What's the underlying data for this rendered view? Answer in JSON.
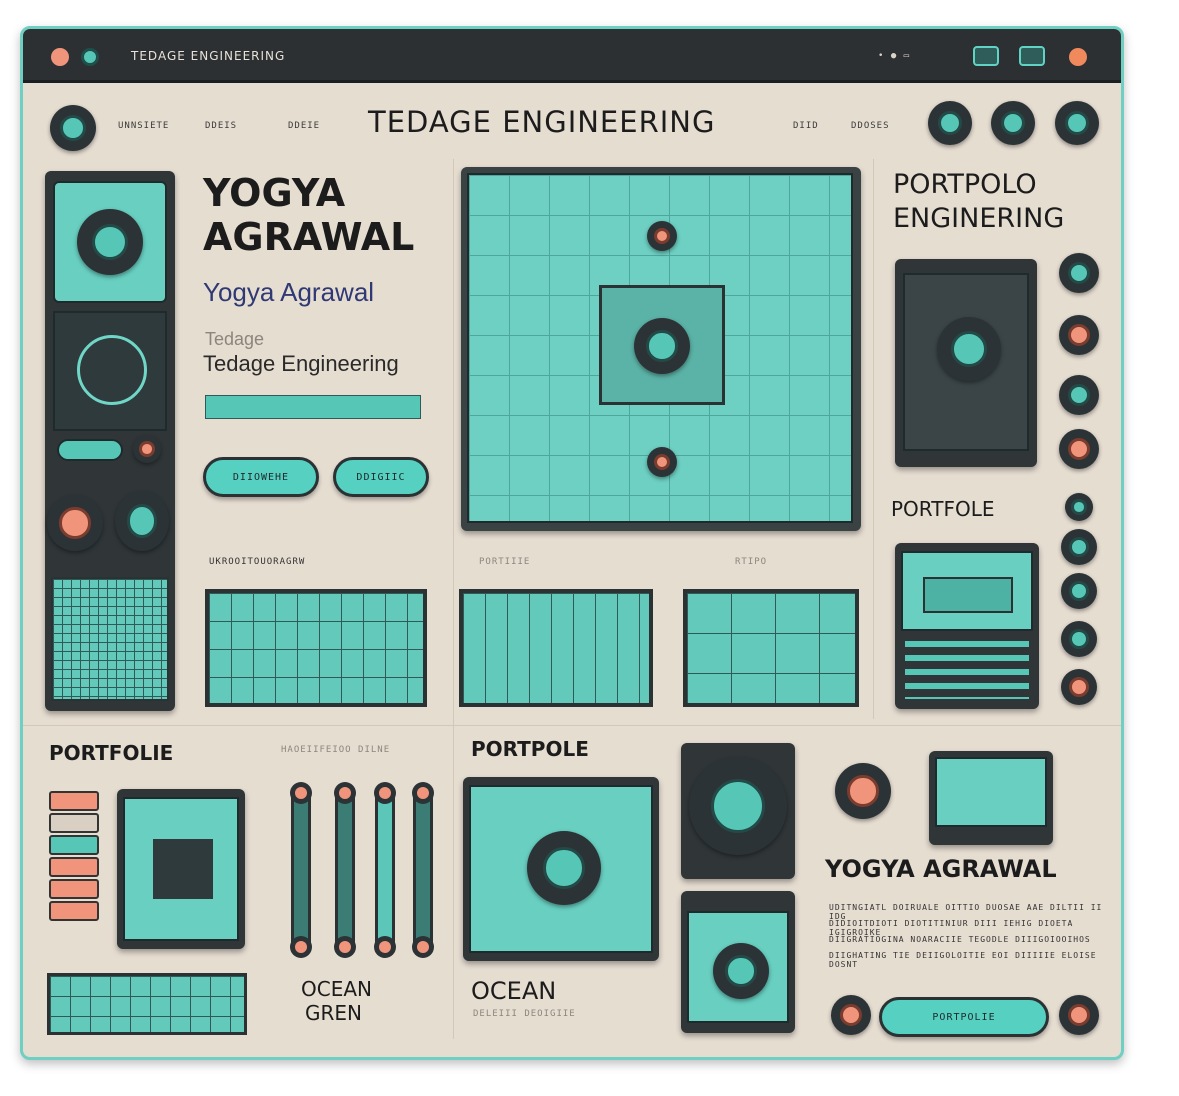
{
  "window": {
    "app_title": "TEDAGE ENGINEERING"
  },
  "nav": {
    "items_left": [
      "UNNSIETE",
      "DDEIS",
      "DDEIE"
    ],
    "items_right": [
      "DIID",
      "DDOSES"
    ],
    "brand": "TEDAGE ENGINEERING"
  },
  "hero": {
    "name": "YOGYA AGRAWAL",
    "subtitle": "Yogya Agrawal",
    "small_label": "Tedage",
    "company": "Tedage Engineering",
    "buttons": [
      "DIIOWEHE",
      "DDIGIIC"
    ]
  },
  "portfolio_header": {
    "line1": "PORTPOLO",
    "line2": "ENGINERING"
  },
  "sections": {
    "portfole_right": "PORTFOLE",
    "strip_labels": [
      "UKROOITOUORAGRW",
      "PORTIIIE",
      "RTIPO"
    ],
    "portfolie_bottom": "PORTFOLIE",
    "portfolie_caption": "HAOEIIFEIOO DILNE",
    "portpole_center": "PORTPOLE",
    "ocean_left_line1": "OCEAN",
    "ocean_left_line2": "GREN",
    "ocean_center": "OCEAN",
    "ocean_center_caption": "DELEIII DEOIGIIE"
  },
  "profile_card": {
    "name": "YOGYA AGRAWAL",
    "body": [
      "UDITNGIATL DOIRUALE OITTIO DUOSAE AAE DILTII II IDG",
      "DIDIOITDIOTI DIOTITINIUR DIII IEHIG DIOETA IGIGROIKE",
      "DIIGRATIOGINA NOARACIIE TEGODLE DIIIGOIOOIHOS",
      "DIIGHATING TIE DEIIGOLOITIE EOI DIIIIIE ELOISE DOSNT"
    ],
    "button": "PORTPOLIE"
  },
  "colors": {
    "accent": "#56c7b7",
    "coral": "#f0957b",
    "dark": "#2c3336",
    "background": "#e6ddd1"
  }
}
